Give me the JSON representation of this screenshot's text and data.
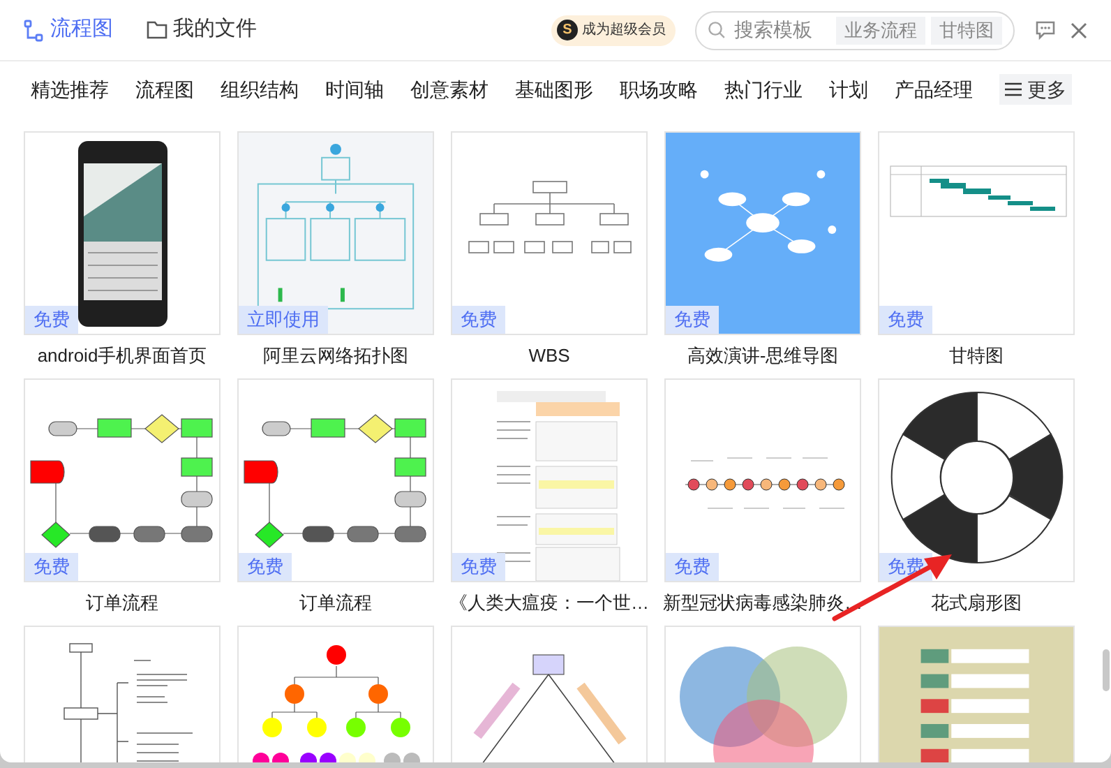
{
  "header": {
    "app_tab": "流程图",
    "files_tab": "我的文件",
    "vip_button": "成为超级会员",
    "vip_icon_letter": "S",
    "search": {
      "placeholder": "搜索模板",
      "chips": [
        "业务流程",
        "甘特图"
      ]
    }
  },
  "categories": [
    "精选推荐",
    "流程图",
    "组织结构",
    "时间轴",
    "创意素材",
    "基础图形",
    "职场攻略",
    "热门行业",
    "计划",
    "产品经理"
  ],
  "more_button": "更多",
  "templates": [
    {
      "kind": "phone",
      "badge": "免费",
      "title": "android手机界面首页"
    },
    {
      "kind": "network",
      "badge": "立即使用",
      "title": "阿里云网络拓扑图"
    },
    {
      "kind": "tree",
      "badge": "免费",
      "title": "WBS"
    },
    {
      "kind": "mindmap",
      "badge": "免费",
      "title": "高效演讲-思维导图"
    },
    {
      "kind": "gantt",
      "badge": "免费",
      "title": "甘特图"
    },
    {
      "kind": "flowchart",
      "badge": "免费",
      "title": "订单流程"
    },
    {
      "kind": "flowchart",
      "badge": "免费",
      "title": "订单流程"
    },
    {
      "kind": "document",
      "badge": "免费",
      "title": "《人类大瘟疫：一个世…"
    },
    {
      "kind": "timeline",
      "badge": "免费",
      "title": "新型冠状病毒感染肺炎…"
    },
    {
      "kind": "ring",
      "badge": "免费",
      "title": "花式扇形图"
    },
    {
      "kind": "outline"
    },
    {
      "kind": "orgchart"
    },
    {
      "kind": "triangle"
    },
    {
      "kind": "venn"
    },
    {
      "kind": "table"
    }
  ],
  "annotation": {
    "kind": "arrow"
  }
}
